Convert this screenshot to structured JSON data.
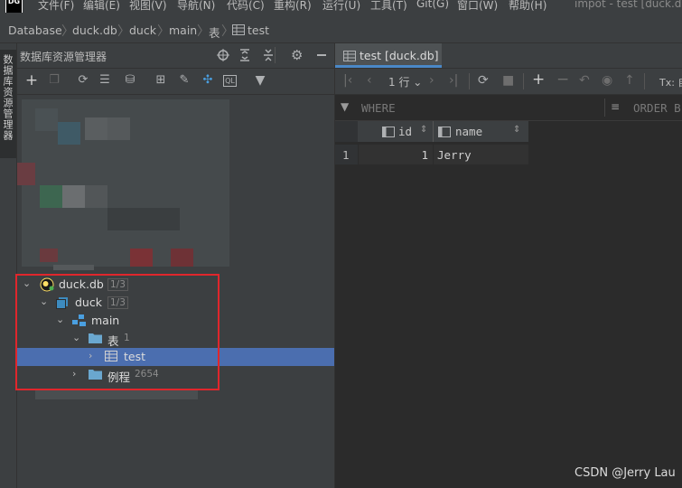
{
  "window": {
    "logo": "DG",
    "title": "impot - test [duck.db"
  },
  "menu": [
    "文件(F)",
    "编辑(E)",
    "视图(V)",
    "导航(N)",
    "代码(C)",
    "重构(R)",
    "运行(U)",
    "工具(T)",
    "Git(G)",
    "窗口(W)",
    "帮助(H)"
  ],
  "breadcrumb": [
    "Database",
    "duck.db",
    "duck",
    "main",
    "表",
    "test"
  ],
  "left_strip": {
    "label": "数据库资源管理器"
  },
  "panel": {
    "title": "数据库资源管理器"
  },
  "tree": [
    {
      "label": "duck.db",
      "count": "1/3"
    },
    {
      "label": "duck",
      "count": "1/3"
    },
    {
      "label": "main",
      "count": ""
    },
    {
      "label": "表",
      "count": "1"
    },
    {
      "label": "test",
      "count": ""
    },
    {
      "label": "例程",
      "count": "2654"
    }
  ],
  "editor": {
    "tab_label": "test [duck.db]",
    "rows_label": "1 行",
    "tx_label": "Tx: 自",
    "where_label": "WHERE",
    "order_label": "ORDER B",
    "columns": [
      "id",
      "name"
    ],
    "rows": [
      {
        "num": "1",
        "id": "1",
        "name": "Jerry"
      }
    ]
  },
  "watermark": "CSDN @Jerry Lau",
  "colors": {
    "selection": "#4b6eaf",
    "highlight_box": "#e0262c",
    "tab_underline": "#4a88c7"
  }
}
